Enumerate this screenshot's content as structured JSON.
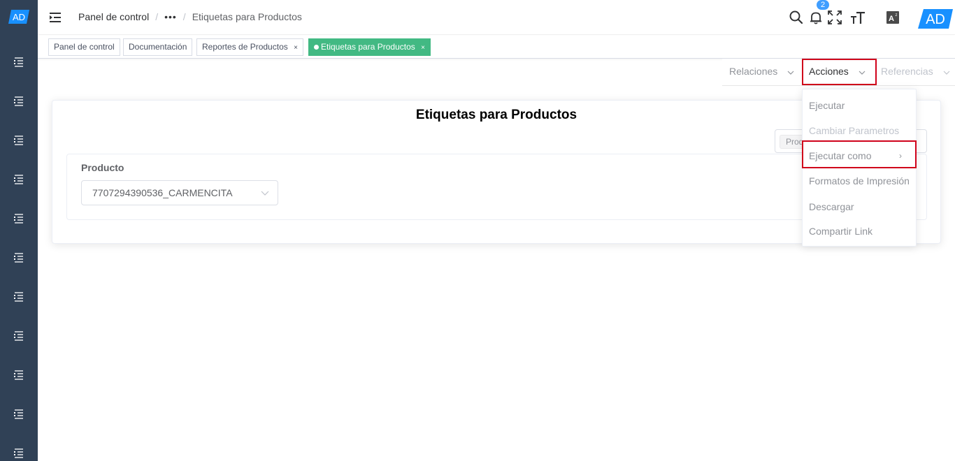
{
  "sidebar": {
    "logo": "AD",
    "items": [
      {
        "icon": "menu-list-icon"
      },
      {
        "icon": "menu-list-icon"
      },
      {
        "icon": "menu-list-icon"
      },
      {
        "icon": "menu-list-icon"
      },
      {
        "icon": "menu-list-icon"
      },
      {
        "icon": "menu-list-icon"
      },
      {
        "icon": "menu-list-icon"
      },
      {
        "icon": "menu-list-icon"
      },
      {
        "icon": "menu-list-icon"
      },
      {
        "icon": "menu-list-icon"
      },
      {
        "icon": "menu-list-icon"
      }
    ]
  },
  "navbar": {
    "breadcrumb": {
      "home": "Panel de control",
      "separator": "/",
      "ellipsis": "•••",
      "current": "Etiquetas para Productos"
    },
    "notifications_count": "2",
    "brand": "AD"
  },
  "tags": [
    {
      "label": "Panel de control",
      "closable": false,
      "active": false
    },
    {
      "label": "Documentación",
      "closable": false,
      "active": false
    },
    {
      "label": "Reportes de Productos",
      "closable": true,
      "active": false
    },
    {
      "label": "Etiquetas para Productos",
      "closable": true,
      "active": true
    }
  ],
  "tag_close_glyph": "×",
  "menubar": {
    "relations": "Relaciones",
    "actions": "Acciones",
    "references": "Referencias"
  },
  "card": {
    "title": "Etiquetas para Productos",
    "chip": "Producto",
    "field_label": "Producto",
    "field_value": "7707294390536_CARMENCITA"
  },
  "dropdown": {
    "items": [
      {
        "label": "Ejecutar",
        "disabled": false
      },
      {
        "label": "Cambiar Parametros",
        "disabled": true
      },
      {
        "label": "Ejecutar como",
        "disabled": false,
        "submenu": true
      },
      {
        "label": "Formatos de Impresión",
        "disabled": false
      },
      {
        "label": "Descargar",
        "disabled": false
      },
      {
        "label": "Compartir Link",
        "disabled": false
      }
    ],
    "submenu_arrow": "›"
  },
  "colors": {
    "sidebar": "#304156",
    "brand_blue": "#1890ff",
    "active_tag": "#42b983",
    "highlight": "#d0021b",
    "badge": "#409eff"
  }
}
